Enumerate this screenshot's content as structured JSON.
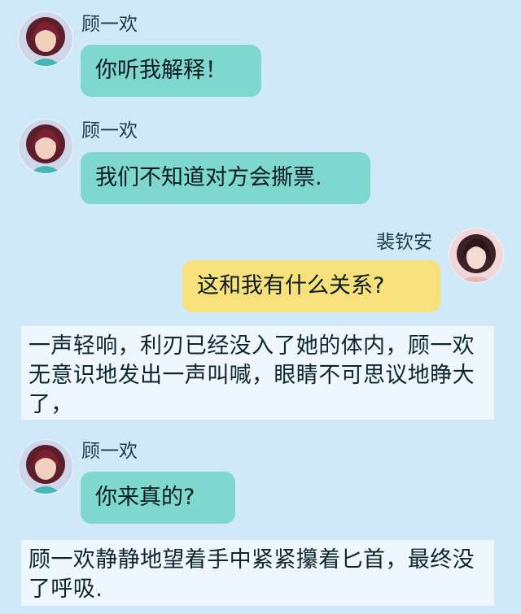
{
  "colors": {
    "background": "#cfe9f8",
    "left_bubble": "#7fd8cd",
    "right_bubble": "#f8e07a",
    "narration_bg": "#edf7fd"
  },
  "messages": [
    {
      "side": "left",
      "speaker": "顾一欢",
      "text": "你听我解释！"
    },
    {
      "side": "left",
      "speaker": "顾一欢",
      "text": "我们不知道对方会撕票."
    },
    {
      "side": "right",
      "speaker": "裴钦安",
      "text": "这和我有什么关系?"
    },
    {
      "side": "left",
      "speaker": "顾一欢",
      "text": "你来真的?"
    }
  ],
  "narrations": [
    "一声轻响，利刃已经没入了她的体内，顾一欢无意识地发出一声叫喊，眼睛不可思议地睁大了，",
    "顾一欢静静地望着手中紧紧攥着匕首，最终没了呼吸."
  ]
}
